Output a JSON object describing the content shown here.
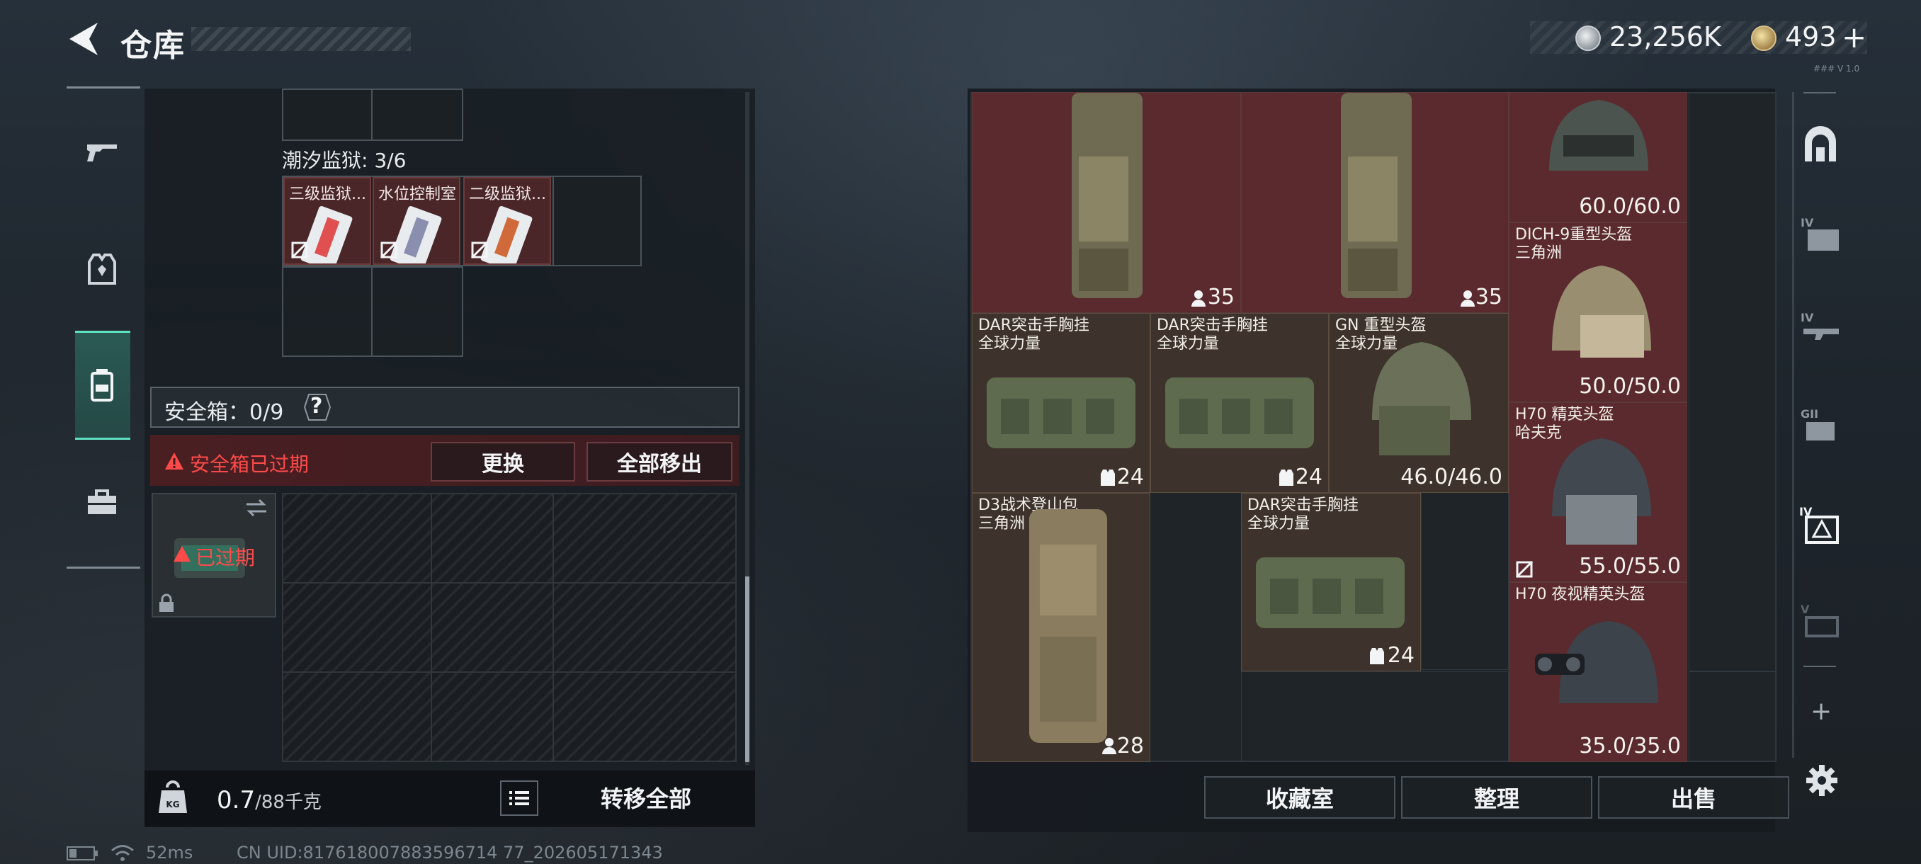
{
  "header": {
    "title": "仓库"
  },
  "currency": {
    "silver_value": "23,256K",
    "gold_value": "493",
    "plus_label": "+",
    "version": "### V 1.0"
  },
  "left_nav": {
    "items": [
      {
        "icon": "gun-icon"
      },
      {
        "icon": "armor-vest-icon"
      },
      {
        "icon": "backpack-icon",
        "active": true
      },
      {
        "icon": "briefcase-icon"
      }
    ]
  },
  "inventory": {
    "region_label": "潮汐监狱: 3/6",
    "keys": [
      {
        "name": "三级监狱...",
        "tint": "#e05050"
      },
      {
        "name": "水位控制室",
        "tint": "#8a8fb0"
      },
      {
        "name": "二级监狱...",
        "tint": "#d06a3a"
      }
    ],
    "safebox_label": "安全箱：0/9",
    "help_label": "?",
    "warning_text": "安全箱已过期",
    "replace_label": "更换",
    "move_all_label": "全部移出",
    "expired_label": "已过期",
    "weight_value": "0.7",
    "weight_unit": "/88千克",
    "transfer_all_label": "转移全部"
  },
  "stash": {
    "items": [
      {
        "id": "rig-a",
        "name": "",
        "value": "35",
        "value_icon": "person-icon"
      },
      {
        "id": "rig-b",
        "name": "",
        "value": "35",
        "value_icon": "person-icon"
      },
      {
        "id": "helmet-top",
        "name": "",
        "value": "60.0/60.0"
      },
      {
        "id": "dich9",
        "name": "DICH-9重型头盔\n三角洲",
        "value": "50.0/50.0"
      },
      {
        "id": "dar1",
        "name": "DAR突击手胸挂\n全球力量",
        "value": "24",
        "value_icon": "vest-icon"
      },
      {
        "id": "dar2",
        "name": "DAR突击手胸挂\n全球力量",
        "value": "24",
        "value_icon": "vest-icon"
      },
      {
        "id": "gn",
        "name": "GN 重型头盔\n全球力量",
        "value": "46.0/46.0"
      },
      {
        "id": "h70",
        "name": "H70 精英头盔\n哈夫克",
        "value": "55.0/55.0"
      },
      {
        "id": "d3",
        "name": "D3战术登山包\n三角洲",
        "value": "28",
        "value_icon": "person-icon"
      },
      {
        "id": "dar3",
        "name": "DAR突击手胸挂\n全球力量",
        "value": "24",
        "value_icon": "vest-icon"
      },
      {
        "id": "h70nv",
        "name": "H70 夜视精英头盔",
        "value": "35.0/35.0"
      }
    ],
    "buttons": {
      "collection": "收藏室",
      "organize": "整理",
      "sell": "出售"
    }
  },
  "right_rail": {
    "items": [
      {
        "icon": "arch-icon"
      },
      {
        "icon": "tier-iv-folder-icon"
      },
      {
        "icon": "tier-iv-rifle-icon"
      },
      {
        "icon": "tier-ii-case-icon"
      },
      {
        "icon": "tier-iv-active-icon",
        "active": true
      },
      {
        "icon": "tier-v-case-icon"
      },
      {
        "icon": "add-icon"
      },
      {
        "icon": "gear-icon"
      }
    ],
    "add_label": "+"
  },
  "status": {
    "ping": "52ms",
    "uid": "CN UID:817618007883596714 77_202605171343"
  },
  "colors": {
    "accent_teal": "#5fe0c0",
    "warning_red": "#ff4a4a",
    "item_red": "#5a2a2e",
    "item_brown": "#3d332c"
  }
}
